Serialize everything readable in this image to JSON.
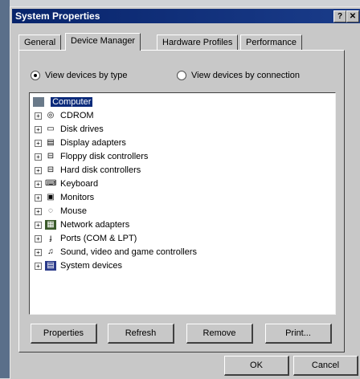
{
  "window": {
    "title": "System Properties",
    "help_btn": "?",
    "close_btn": "✕"
  },
  "tabs": [
    {
      "label": "General"
    },
    {
      "label": "Device Manager"
    },
    {
      "label": "Hardware Profiles"
    },
    {
      "label": "Performance"
    }
  ],
  "view": {
    "by_type": "View devices by type",
    "by_connection": "View devices by connection"
  },
  "tree": {
    "root": "Computer",
    "items": [
      {
        "label": "CDROM",
        "icon": "cdrom-icon"
      },
      {
        "label": "Disk drives",
        "icon": "disk-drive-icon"
      },
      {
        "label": "Display adapters",
        "icon": "display-adapter-icon"
      },
      {
        "label": "Floppy disk controllers",
        "icon": "floppy-controller-icon"
      },
      {
        "label": "Hard disk controllers",
        "icon": "hard-disk-controller-icon"
      },
      {
        "label": "Keyboard",
        "icon": "keyboard-icon"
      },
      {
        "label": "Monitors",
        "icon": "monitor-icon"
      },
      {
        "label": "Mouse",
        "icon": "mouse-icon"
      },
      {
        "label": "Network adapters",
        "icon": "network-adapter-icon"
      },
      {
        "label": "Ports (COM & LPT)",
        "icon": "port-icon"
      },
      {
        "label": "Sound, video and game controllers",
        "icon": "sound-icon"
      },
      {
        "label": "System devices",
        "icon": "system-devices-icon"
      }
    ]
  },
  "buttons": {
    "properties": "Properties",
    "refresh": "Refresh",
    "remove": "Remove",
    "print": "Print...",
    "ok": "OK",
    "cancel": "Cancel"
  }
}
